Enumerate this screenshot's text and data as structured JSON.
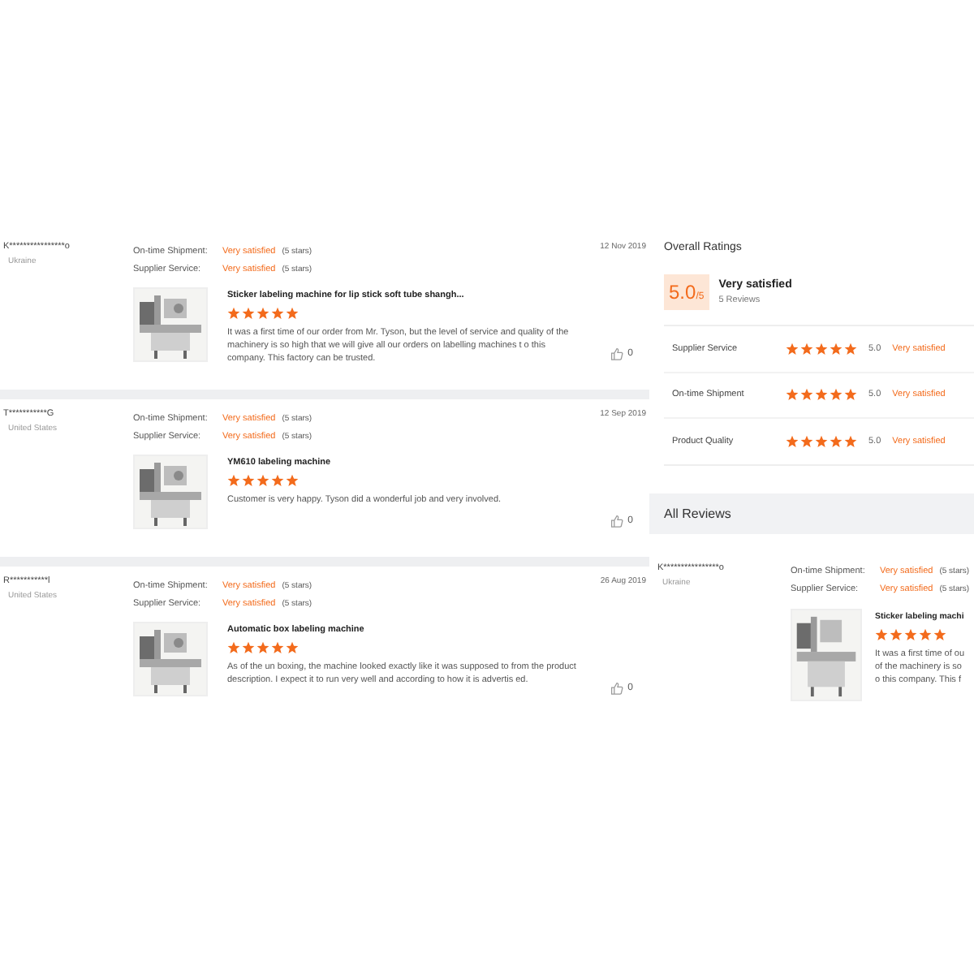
{
  "reviews": [
    {
      "name": "K****************o",
      "country": "Ukraine",
      "date": "12 Nov 2019",
      "ratings": [
        {
          "label": "On-time Shipment:",
          "verdict": "Very satisfied",
          "detail": "(5 stars)"
        },
        {
          "label": "Supplier Service:",
          "verdict": "Very satisfied",
          "detail": "(5 stars)"
        }
      ],
      "product": "Sticker labeling machine for lip stick soft tube shangh...",
      "stars": 5,
      "body": "It was a first time of our order from Mr. Tyson, but the level of service and quality of the machinery is so high that we will give all our orders on labelling machines t o this company. This factory can be trusted.",
      "likes": "0"
    },
    {
      "name": "T***********G",
      "country": "United States",
      "date": "12 Sep 2019",
      "ratings": [
        {
          "label": "On-time Shipment:",
          "verdict": "Very satisfied",
          "detail": "(5 stars)"
        },
        {
          "label": "Supplier Service:",
          "verdict": "Very satisfied",
          "detail": "(5 stars)"
        }
      ],
      "product": "YM610 labeling machine",
      "stars": 5,
      "body": "Customer is very happy. Tyson did a wonderful job and very involved.",
      "likes": "0"
    },
    {
      "name": "R***********l",
      "country": "United States",
      "date": "26 Aug 2019",
      "ratings": [
        {
          "label": "On-time Shipment:",
          "verdict": "Very satisfied",
          "detail": "(5 stars)"
        },
        {
          "label": "Supplier Service:",
          "verdict": "Very satisfied",
          "detail": "(5 stars)"
        }
      ],
      "product": "Automatic box labeling machine",
      "stars": 5,
      "body": "As of the un boxing, the machine looked exactly like it was supposed to from the product description. I expect it to run very well and according to how it is advertis ed.",
      "likes": "0"
    }
  ],
  "overall": {
    "title": "Overall Ratings",
    "score": "5.0",
    "scale": "/5",
    "verdict": "Very satisfied",
    "count": "5 Reviews",
    "rows": [
      {
        "label": "Supplier Service",
        "stars": 5,
        "value": "5.0",
        "verdict": "Very satisfied"
      },
      {
        "label": "On-time Shipment",
        "stars": 5,
        "value": "5.0",
        "verdict": "Very satisfied"
      },
      {
        "label": "Product Quality",
        "stars": 5,
        "value": "5.0",
        "verdict": "Very satisfied"
      }
    ]
  },
  "all_reviews": {
    "title": "All Reviews",
    "review": {
      "name": "K****************o",
      "country": "Ukraine",
      "ratings": [
        {
          "label": "On-time Shipment:",
          "verdict": "Very satisfied",
          "detail": "(5 stars)"
        },
        {
          "label": "Supplier Service:",
          "verdict": "Very satisfied",
          "detail": "(5 stars)"
        }
      ],
      "product": "Sticker labeling machi",
      "stars": 5,
      "body_lines": [
        "It was a first time of ou",
        "of the machinery is so",
        "o this company. This f"
      ]
    }
  }
}
